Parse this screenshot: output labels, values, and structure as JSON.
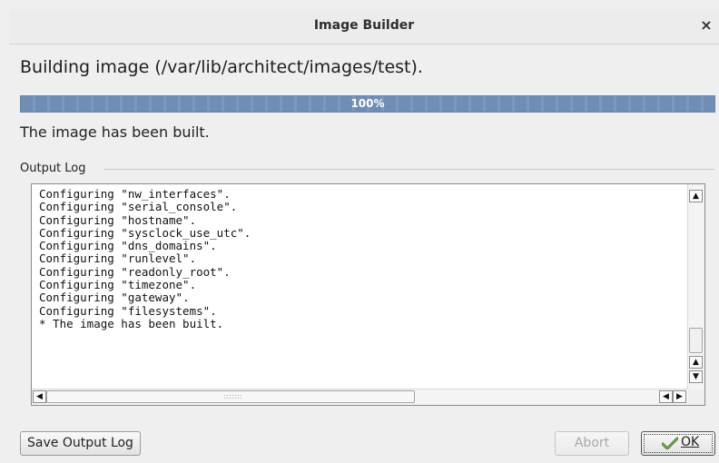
{
  "window": {
    "title": "Image Builder",
    "close_glyph": "×"
  },
  "heading": "Building image (/var/lib/architect/images/test).",
  "progress": {
    "value": 1.0,
    "label": "100%",
    "color": "#6f8db5"
  },
  "status_text": "The image has been built.",
  "output_log": {
    "label": "Output Log",
    "lines": [
      "Configuring \"nw_interfaces\".",
      "Configuring \"serial_console\".",
      "Configuring \"hostname\".",
      "Configuring \"sysclock_use_utc\".",
      "Configuring \"dns_domains\".",
      "Configuring \"runlevel\".",
      "Configuring \"readonly_root\".",
      "Configuring \"timezone\".",
      "Configuring \"gateway\".",
      "Configuring \"filesystems\".",
      "* The image has been built."
    ]
  },
  "buttons": {
    "save_log": "Save Output Log",
    "abort": "Abort",
    "ok": "OK"
  },
  "icons": {
    "close": "close-icon",
    "ok": "check-icon",
    "scroll_up": "arrow-up-icon",
    "scroll_down": "arrow-down-icon",
    "scroll_left": "arrow-left-icon",
    "scroll_right": "arrow-right-icon"
  }
}
